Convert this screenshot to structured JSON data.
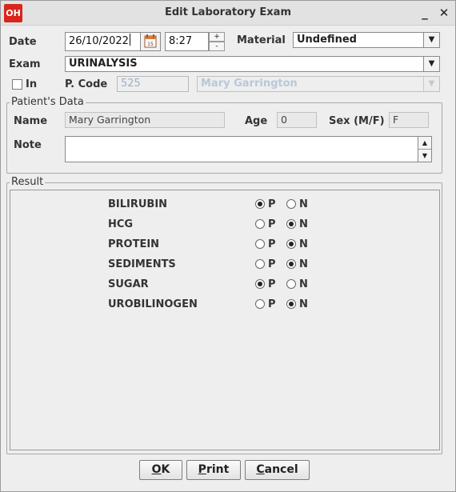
{
  "window": {
    "app_icon_text": "OH",
    "title": "Edit Laboratory Exam",
    "minimize_glyph": "_",
    "close_glyph": "✕"
  },
  "form": {
    "date_label": "Date",
    "date_value": "26/10/2022",
    "time_value": "8:27",
    "spin_up": "+",
    "spin_down": "-",
    "material_label": "Material",
    "material_value": "Undefined",
    "exam_label": "Exam",
    "exam_value": "URINALYSIS",
    "in_label": "In",
    "in_checked": false,
    "pcode_label": "P. Code",
    "pcode_value": "525",
    "patient_combo_value": "Mary Garrington"
  },
  "patient": {
    "group_title": "Patient's Data",
    "name_label": "Name",
    "name_value": "Mary Garrington",
    "age_label": "Age",
    "age_value": "0",
    "sex_label": "Sex (M/F)",
    "sex_value": "F",
    "note_label": "Note",
    "note_value": ""
  },
  "result": {
    "group_title": "Result",
    "options": {
      "positive": "P",
      "negative": "N"
    },
    "rows": [
      {
        "label": "BILIRUBIN",
        "selected": "P"
      },
      {
        "label": "HCG",
        "selected": "N"
      },
      {
        "label": "PROTEIN",
        "selected": "N"
      },
      {
        "label": "SEDIMENTS",
        "selected": "N"
      },
      {
        "label": "SUGAR",
        "selected": "P"
      },
      {
        "label": "UROBILINOGEN",
        "selected": "N"
      }
    ]
  },
  "buttons": {
    "ok": {
      "label": "OK",
      "mnemonic": "O"
    },
    "print": {
      "label": "Print",
      "mnemonic": "P"
    },
    "cancel": {
      "label": "Cancel",
      "mnemonic": "C"
    }
  },
  "colors": {
    "app_icon": "#d9261c",
    "disabled_text": "#9ab0c8"
  }
}
